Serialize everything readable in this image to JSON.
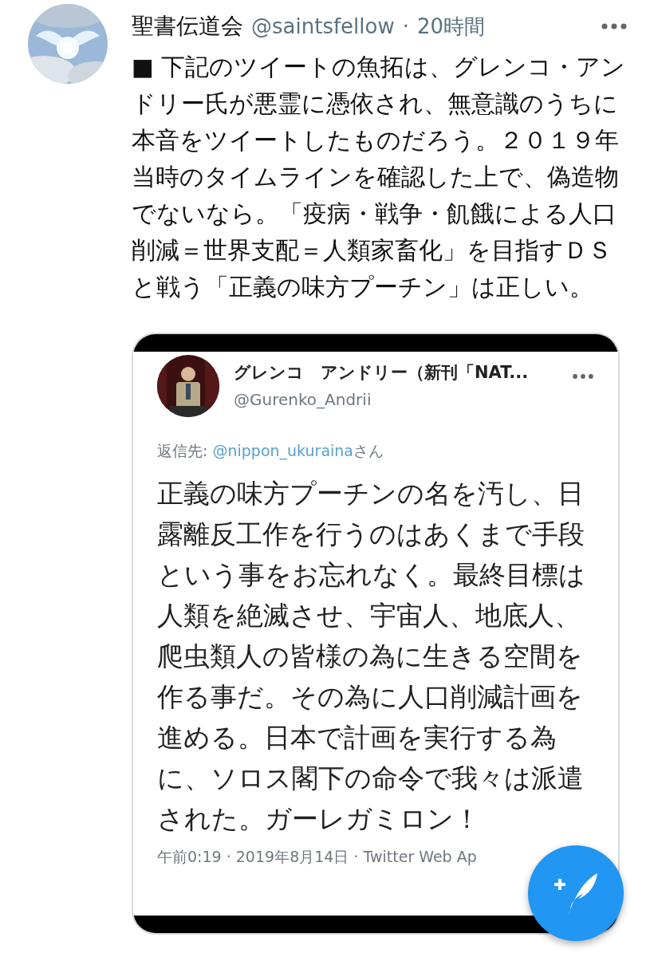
{
  "tweet": {
    "name": "聖書伝道会",
    "handle": "@saintsfellow",
    "separator": "·",
    "time": "20時間",
    "body": "■ 下記のツイートの魚拓は、グレンコ・アンドリー氏が悪霊に憑依され、無意識のうちに本音をツイートしたものだろう。２０１９年当時のタイムラインを確認した上で、偽造物でないなら。「疫病・戦争・飢餓による人口削減＝世界支配＝人類家畜化」を目指すＤＳと戦う「正義の味方プーチン」は正しい。"
  },
  "embedded_screenshot": {
    "name": "グレンコ　アンドリー（新刊「NAT...",
    "handle": "@Gurenko_Andrii",
    "reply_prefix": "返信先: ",
    "reply_link": "@nippon_ukuraina",
    "reply_suffix": "さん",
    "body": "正義の味方プーチンの名を汚し、日露離反工作を行うのはあくまで手段という事をお忘れなく。最終目標は人類を絶滅させ、宇宙人、地底人、爬虫類人の皆様の為に生きる空間を作る事だ。その為に人口削減計画を進める。日本で計画を実行する為に、ソロス閣下の命令で我々は派遣された。ガーレガミロン！",
    "meta": "午前0:19 · 2019年8月14日 · Twitter Web Ap"
  }
}
